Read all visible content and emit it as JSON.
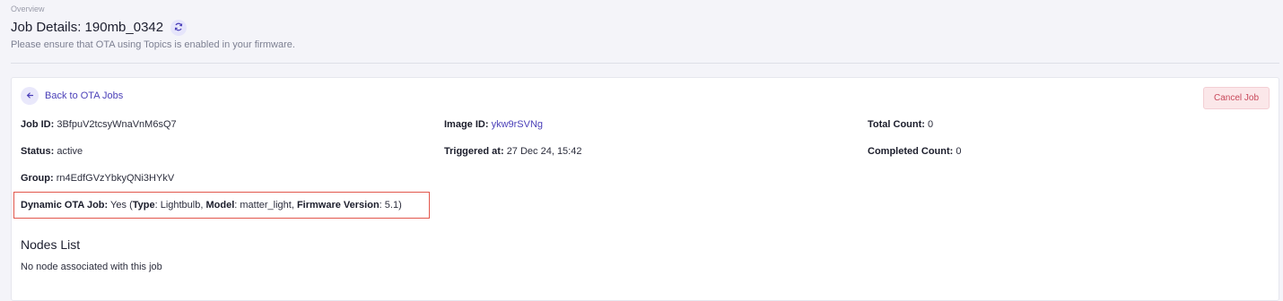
{
  "breadcrumb": "Overview",
  "page_title": "Job Details: 190mb_0342",
  "subtitle": "Please ensure that OTA using Topics is enabled in your firmware.",
  "back_label": "Back to OTA Jobs",
  "cancel_label": "Cancel Job",
  "fields": {
    "job_id": {
      "label": "Job ID:",
      "value": "3BfpuV2tcsyWnaVnM6sQ7"
    },
    "status": {
      "label": "Status:",
      "value": "active"
    },
    "group": {
      "label": "Group:",
      "value": "rn4EdfGVzYbkyQNi3HYkV"
    },
    "image_id": {
      "label": "Image ID:",
      "value": "ykw9rSVNg"
    },
    "triggered_at": {
      "label": "Triggered at:",
      "value": "27 Dec 24, 15:42"
    },
    "total_count": {
      "label": "Total Count:",
      "value": "0"
    },
    "completed_count": {
      "label": "Completed Count:",
      "value": "0"
    }
  },
  "dynamic_ota": {
    "label": "Dynamic OTA Job:",
    "value": "Yes",
    "open": "(",
    "type_label": "Type",
    "type_value": ": Lightbulb, ",
    "model_label": "Model",
    "model_value": ": matter_light, ",
    "fw_label": "Firmware Version",
    "fw_value": ": 5.1)"
  },
  "nodes": {
    "title": "Nodes List",
    "empty": "No node associated with this job"
  },
  "colors": {
    "accent": "#4a3fb8",
    "danger": "#c8485a",
    "highlight": "#e2574c"
  },
  "icons": {
    "refresh": "refresh-icon",
    "back": "arrow-left-icon"
  }
}
